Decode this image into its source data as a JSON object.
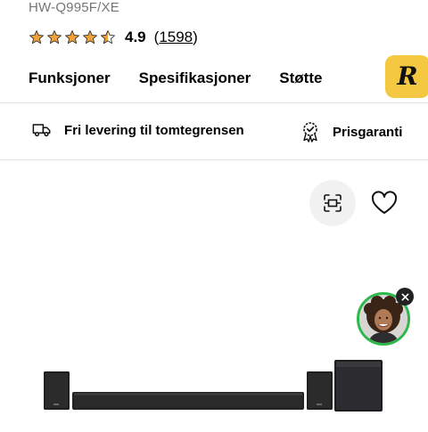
{
  "product": {
    "model": "HW-Q995F/XE",
    "rating": "4.9",
    "rating_stars": 4.5,
    "reviews_count_text": "1598",
    "reviews_open": "(",
    "reviews_close": ")"
  },
  "tabs": [
    {
      "label": "Funksjoner"
    },
    {
      "label": "Spesifikasjoner"
    },
    {
      "label": "Støtte"
    }
  ],
  "badge": {
    "letter": "R",
    "color": "#f5c842"
  },
  "usps": [
    {
      "icon": "delivery-truck-icon",
      "label": "Fri levering til tomtegrensen"
    },
    {
      "icon": "price-guarantee-icon",
      "label": "Prisgaranti"
    }
  ],
  "actions": {
    "ar_icon": "ar-view-icon",
    "heart_icon": "heart-icon"
  },
  "chat": {
    "status_color": "#2db84c",
    "close_icon": "close-icon"
  },
  "colors": {
    "star": "#f0a23a",
    "accent_green": "#2db84c"
  }
}
